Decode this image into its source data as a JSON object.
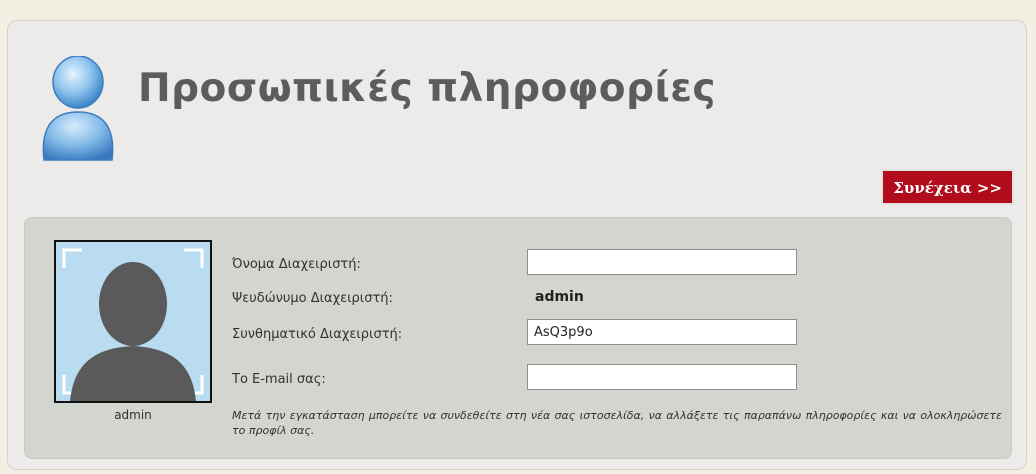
{
  "header": {
    "title": "Προσωπικές πληροφορίες",
    "continue_label": "Συνέχεια >>"
  },
  "form": {
    "avatar_caption": "admin",
    "fields": [
      {
        "label": "Όνομα Διαχειριστή:",
        "value": ""
      },
      {
        "label": "Ψευδώνυμο Διαχειριστή:",
        "value": "admin"
      },
      {
        "label": "Συνθηματικό Διαχειριστή:",
        "value": "AsQ3p9o"
      },
      {
        "label": "Το E-mail σας:",
        "value": ""
      }
    ],
    "note": "Μετά την εγκατάσταση μπορείτε να συνδεθείτε στη νέα σας ιστοσελίδα, να αλλάξετε τις παραπάνω πληροφορίες και να ολοκληρώσετε το προφίλ σας."
  },
  "icons": {
    "header_icon": "user-icon",
    "avatar": "default-avatar-silhouette"
  },
  "colors": {
    "button_bg": "#b10c1c",
    "panel_bg": "#ecebe9",
    "form_bg": "#d2d6ce",
    "avatar_bg": "#b9dcf1"
  }
}
